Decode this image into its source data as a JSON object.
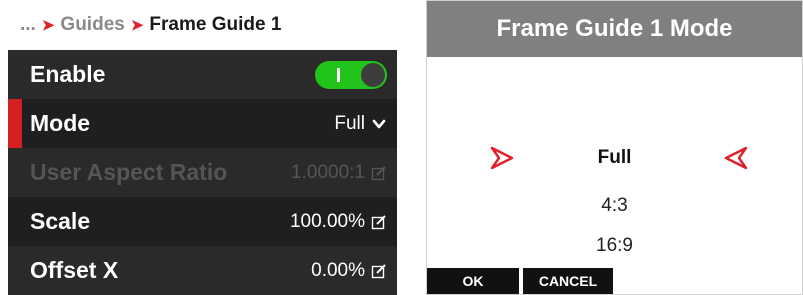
{
  "breadcrumb": {
    "ellipsis": "...",
    "parent": "Guides",
    "current": "Frame Guide 1"
  },
  "menu": {
    "rows": [
      {
        "label": "Enable",
        "control": "toggle",
        "toggle_on": true
      },
      {
        "label": "Mode",
        "value": "Full",
        "selected": true,
        "icon": "chevron-down-icon"
      },
      {
        "label": "User Aspect Ratio",
        "value": "1.0000:1",
        "disabled": true,
        "icon": "edit-icon"
      },
      {
        "label": "Scale",
        "value": "100.00%",
        "icon": "edit-icon"
      },
      {
        "label": "Offset X",
        "value": "0.00%",
        "icon": "edit-icon"
      }
    ]
  },
  "dialog": {
    "title": "Frame Guide 1 Mode",
    "options": [
      "Full",
      "4:3",
      "16:9"
    ],
    "selected_option": "Full",
    "ok_label": "OK",
    "cancel_label": "CANCEL"
  },
  "colors": {
    "accent": "#e0202a",
    "toggle_on": "#22c41c",
    "menu_background": "#111111",
    "dialog_title_background": "#808080"
  }
}
